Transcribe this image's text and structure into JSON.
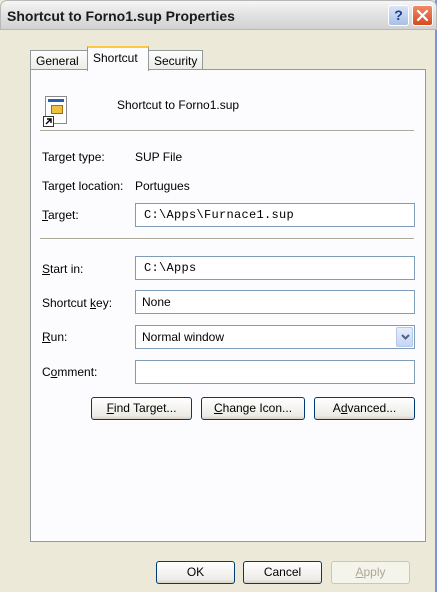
{
  "window": {
    "title": "Shortcut to Forno1.sup Properties"
  },
  "titlebar": {
    "help_label": "?"
  },
  "tabs": [
    {
      "label": "General"
    },
    {
      "label": "Shortcut"
    },
    {
      "label": "Security"
    }
  ],
  "shortcut": {
    "name": "Shortcut to Forno1.sup",
    "target_type_label": "Target type:",
    "target_type_value": "SUP File",
    "target_location_label": "Target location:",
    "target_location_value": "Portugues",
    "target_label_key": "T",
    "target_label_rest": "arget:",
    "target_value": "C:\\Apps\\Furnace1.sup",
    "start_in_label_key": "S",
    "start_in_label_rest": "tart in:",
    "start_in_value": "C:\\Apps",
    "shortcut_key_label_pre": "Shortcut ",
    "shortcut_key_label_key": "k",
    "shortcut_key_label_rest": "ey:",
    "shortcut_key_value": "None",
    "run_label_key": "R",
    "run_label_rest": "un:",
    "run_value": "Normal window",
    "comment_label_pre": "C",
    "comment_label_key": "o",
    "comment_label_rest": "mment:",
    "comment_value": ""
  },
  "buttons": {
    "find_target_key": "F",
    "find_target_rest": "ind Target...",
    "change_icon_key": "C",
    "change_icon_rest": "hange Icon...",
    "advanced_pre": "A",
    "advanced_key": "d",
    "advanced_rest": "vanced...",
    "ok": "OK",
    "cancel": "Cancel",
    "apply_key": "A",
    "apply_rest": "pply"
  },
  "colors": {
    "titlebar": "#e1e1e1",
    "close_button": "#d64a21",
    "active_tab_accent": "#ffc83c",
    "dialog_face": "#ece9d8",
    "field_border": "#7f9db9"
  },
  "icons": {
    "help": "question-mark",
    "close": "x",
    "file": "sup-file-shortcut-icon",
    "dropdown": "chevron-down"
  }
}
